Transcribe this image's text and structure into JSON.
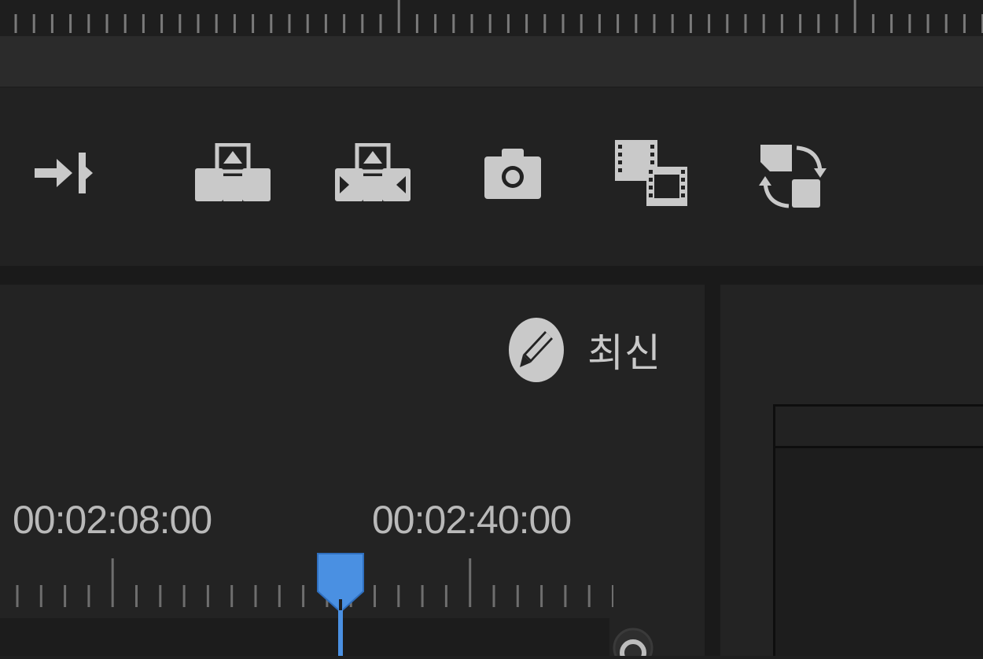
{
  "toolbar": {
    "buttons": [
      {
        "name": "go-to-out-point",
        "icon": "go-to-out-point-icon"
      },
      {
        "name": "lift",
        "icon": "lift-icon"
      },
      {
        "name": "extract",
        "icon": "extract-icon"
      },
      {
        "name": "export-frame",
        "icon": "camera-icon"
      },
      {
        "name": "insert-overwrite",
        "icon": "film-stack-icon"
      },
      {
        "name": "swap",
        "icon": "swap-icon"
      }
    ]
  },
  "update": {
    "icon": "pencil-icon",
    "label": "최신"
  },
  "timeline": {
    "timecodes": [
      "00:02:08:00",
      "00:02:40:00"
    ],
    "playhead_color": "#4a90e2"
  },
  "colors": {
    "background": "#1f1f1f",
    "panel": "#232323",
    "icon": "#c9c9c9",
    "accent": "#4a90e2"
  }
}
